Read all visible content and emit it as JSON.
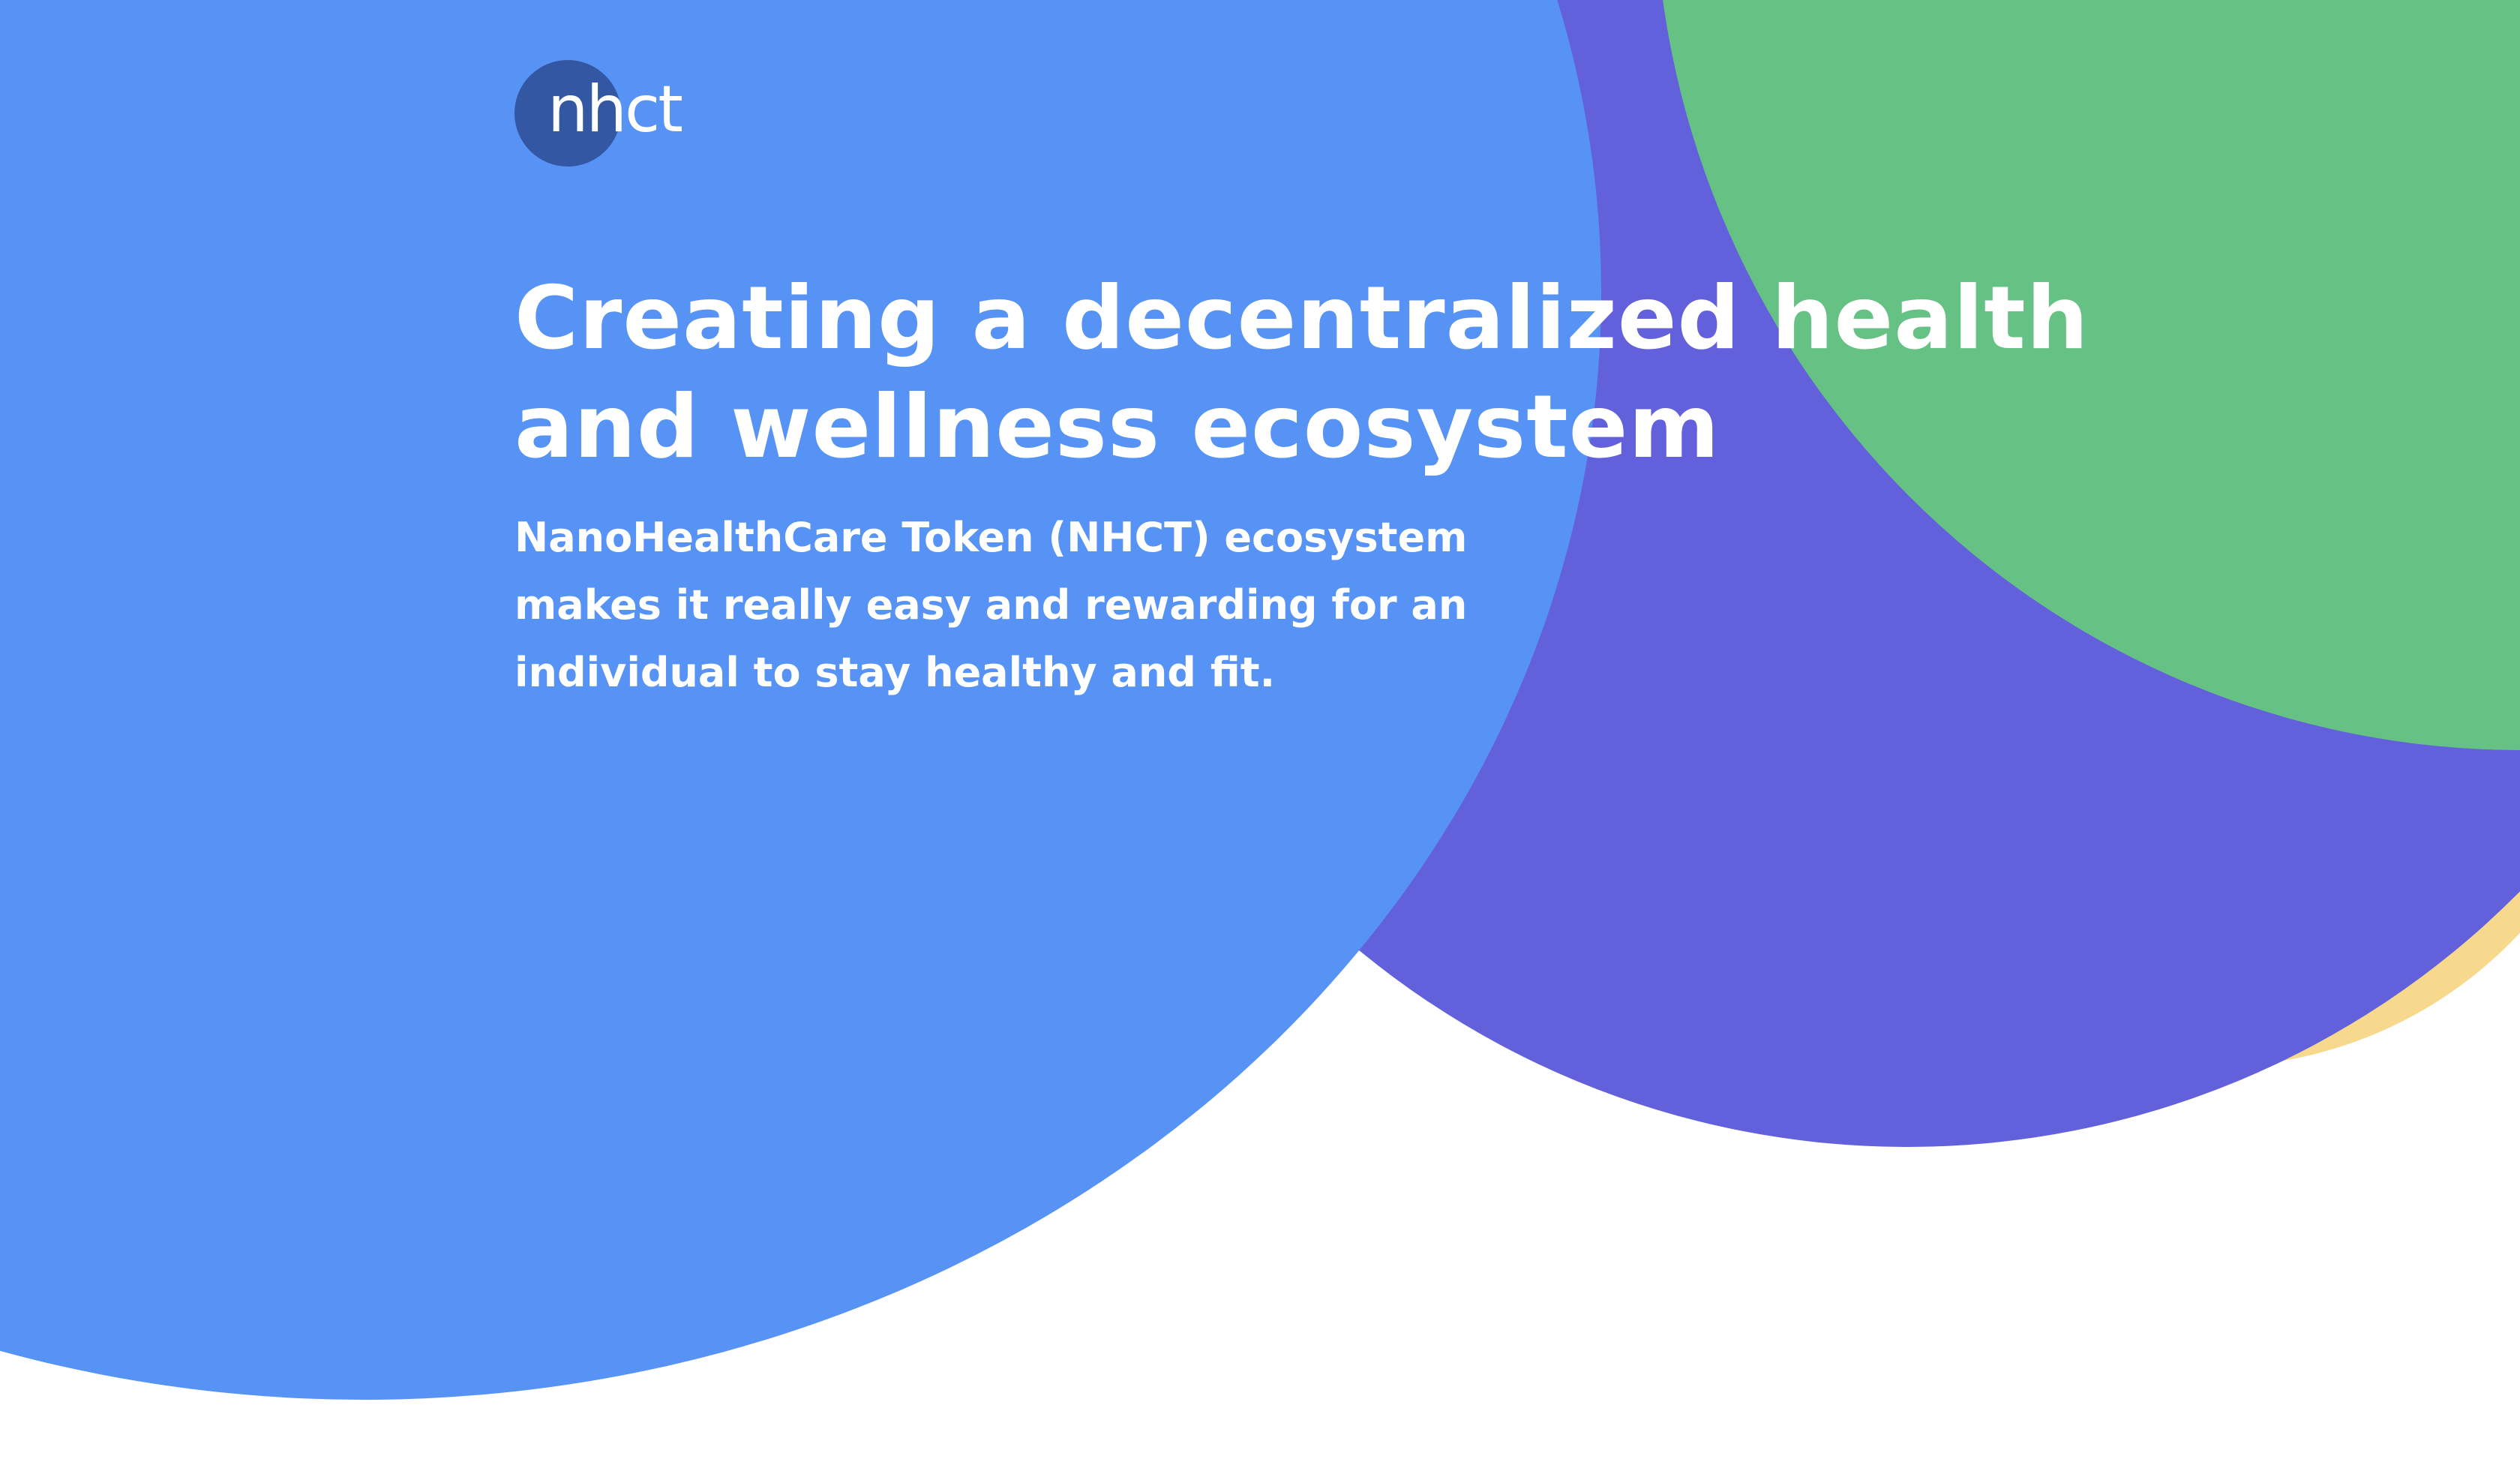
{
  "logo": {
    "text": "nhct",
    "dot_color": "#3357a3"
  },
  "hero": {
    "headline_lines": [
      "Creating a decentralized health",
      "and wellness ecosystem"
    ],
    "description_lines": [
      "NanoHealthCare Token (NHCT) ecosystem",
      "makes it really easy and rewarding for an",
      "individual to stay healthy and fit."
    ]
  },
  "colors": {
    "background": "#ffffff",
    "blue": "#5792f5",
    "purple": "#6360dc",
    "green": "#66c185",
    "yellow": "#f6d98d",
    "text": "#ffffff"
  }
}
